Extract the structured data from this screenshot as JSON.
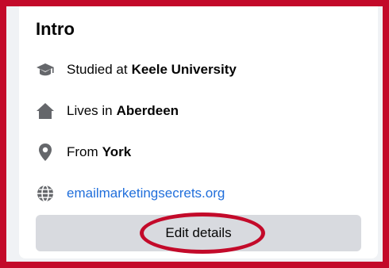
{
  "intro": {
    "title": "Intro",
    "items": [
      {
        "icon": "graduation-cap-icon",
        "label": "Studied at",
        "value": "Keele University"
      },
      {
        "icon": "home-icon",
        "label": "Lives in",
        "value": "Aberdeen"
      },
      {
        "icon": "location-pin-icon",
        "label": "From",
        "value": "York"
      },
      {
        "icon": "globe-icon",
        "link": "emailmarketingsecrets.org"
      }
    ],
    "edit_label": "Edit details"
  },
  "colors": {
    "highlight": "#c30a2a",
    "icon": "#65676b",
    "link": "#216fdb",
    "button_bg": "#d8dadf"
  }
}
